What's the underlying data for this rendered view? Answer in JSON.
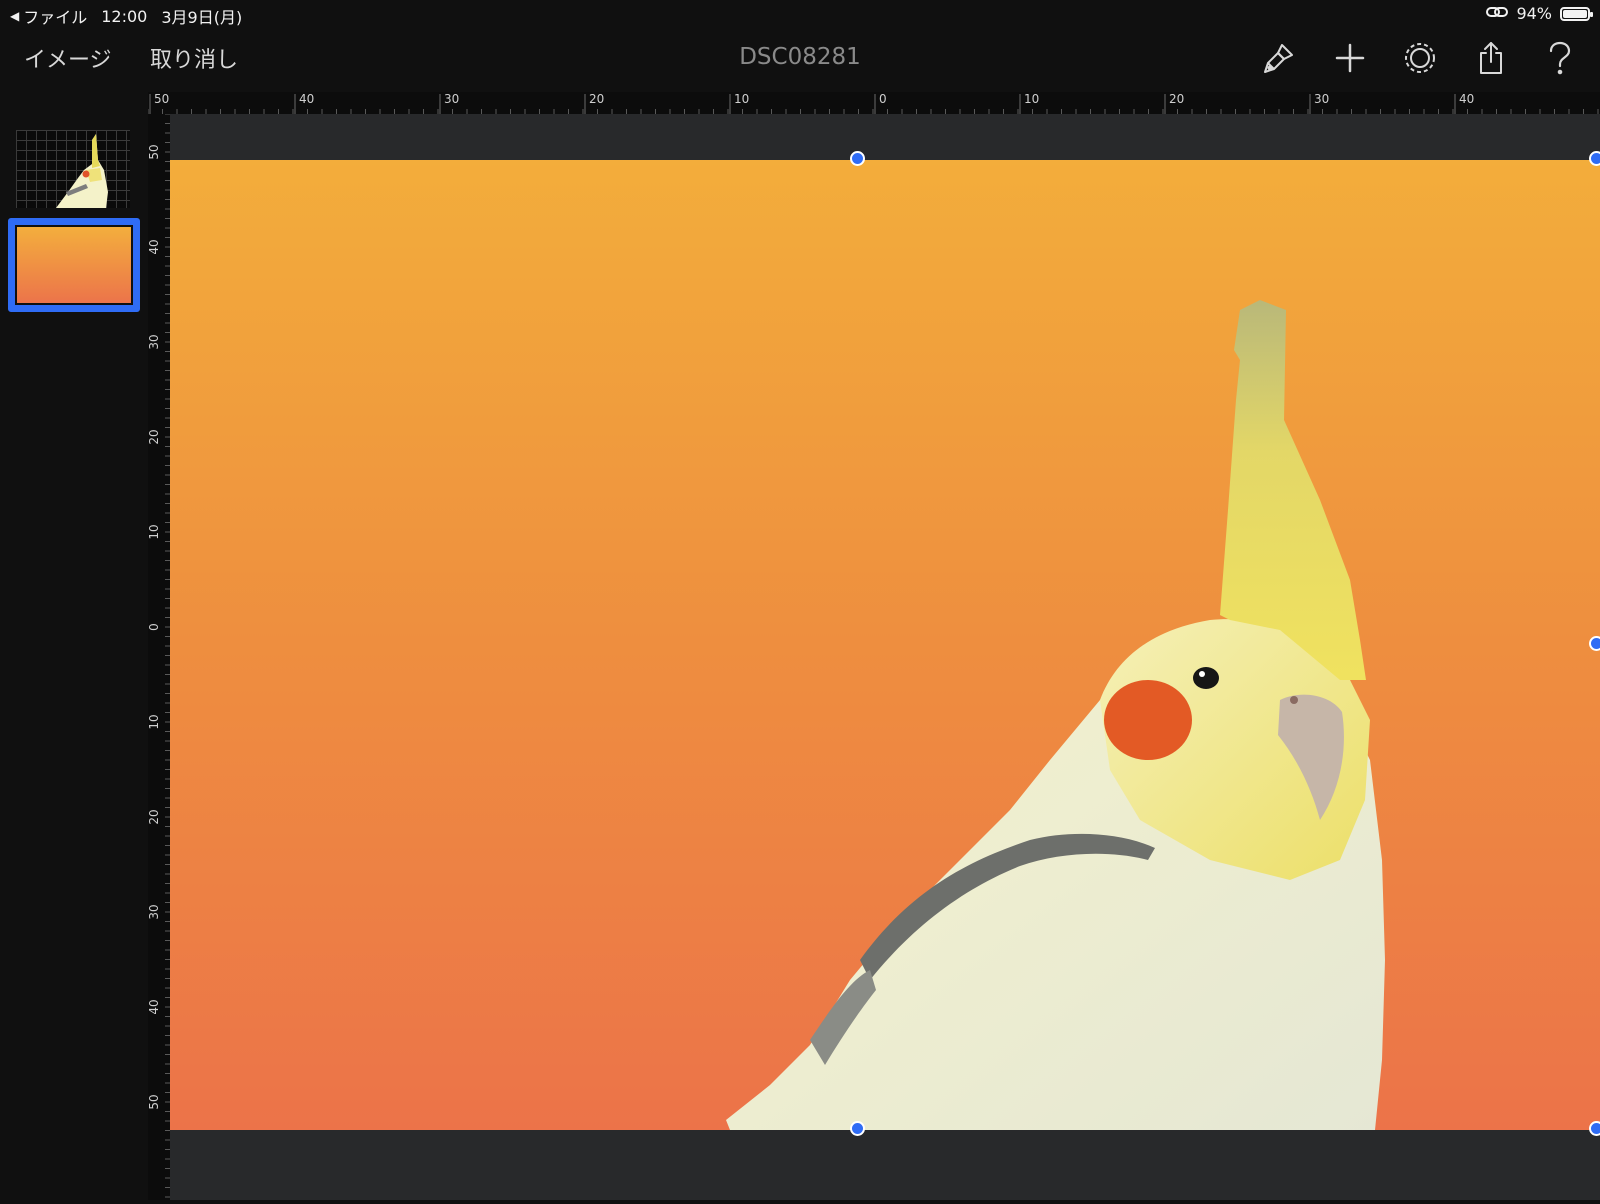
{
  "status_bar": {
    "back_label": "ファイル",
    "time": "12:00",
    "date": "3月9日(月)",
    "battery_percent": "94%",
    "battery_level": 0.94
  },
  "toolbar": {
    "image_button": "イメージ",
    "undo_button": "取り消し",
    "document_title": "DSC08281",
    "icons": [
      "paintbrush-icon",
      "plus-icon",
      "gear-icon",
      "share-icon",
      "help-icon"
    ]
  },
  "ruler_top_labels": [
    "50",
    "40",
    "30",
    "20",
    "10",
    "0",
    "10",
    "20",
    "30",
    "40"
  ],
  "ruler_left_labels": [
    "50",
    "40",
    "30",
    "20",
    "10",
    "0",
    "10",
    "20",
    "30",
    "40",
    "50"
  ],
  "layers": [
    {
      "name": "cockatiel-photo-layer",
      "selected": false
    },
    {
      "name": "orange-gradient-layer",
      "selected": true
    }
  ],
  "colors": {
    "accent": "#2f6cf5",
    "gradient_top": "#f3ad3b",
    "gradient_bottom": "#ec7349",
    "workspace": "#28292b"
  }
}
